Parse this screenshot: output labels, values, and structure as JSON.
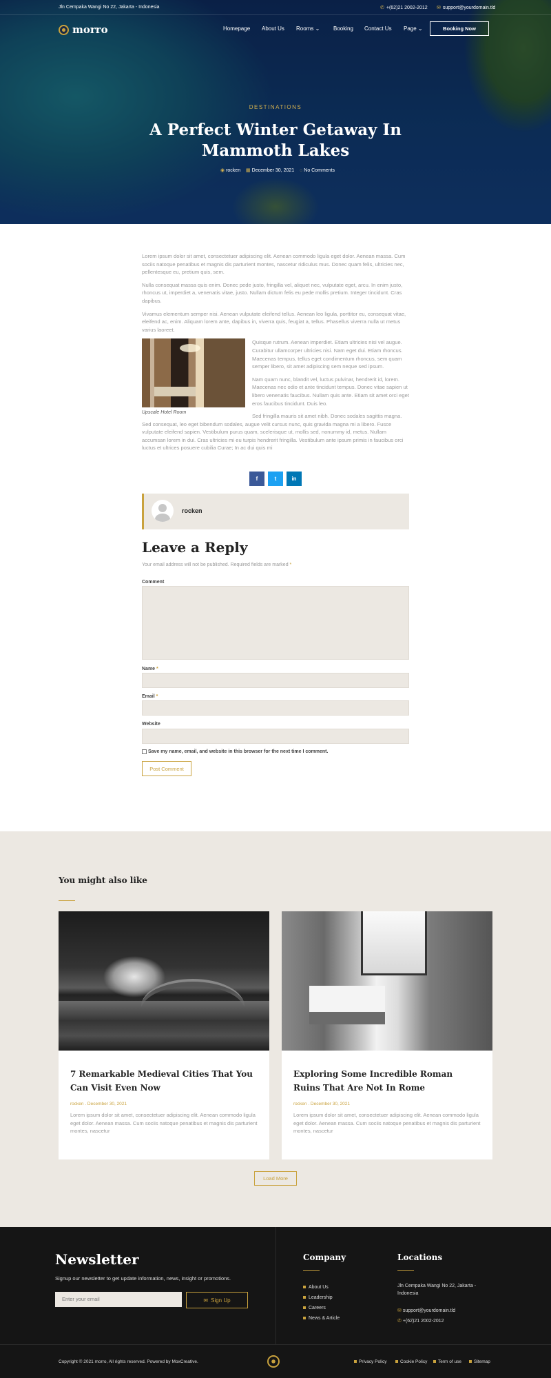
{
  "topbar": {
    "address": "Jln Cempaka Wangi No 22, Jakarta - Indonesia",
    "phone": "+(62)21 2002-2012",
    "email": "support@yourdomain.tld"
  },
  "brand": {
    "name": "morro",
    "accent": "#c9a23d"
  },
  "nav": {
    "items": [
      "Homepage",
      "About Us",
      "Rooms",
      "Booking",
      "Contact Us",
      "Page"
    ],
    "dropdown_arrow": "⌄",
    "cta": "Booking Now"
  },
  "hero": {
    "category": "DESTINATIONS",
    "title": "A Perfect Winter Getaway In Mammoth Lakes",
    "author": "rocken",
    "date": "December 30, 2021",
    "comments": "No Comments"
  },
  "article": {
    "p1": "Lorem ipsum dolor sit amet, consectetuer adipiscing elit. Aenean commodo ligula eget dolor. Aenean massa. Cum sociis natoque penatibus et magnis dis parturient montes, nascetur ridiculus mus. Donec quam felis, ultricies nec, pellentesque eu, pretium quis, sem.",
    "p2": "Nulla consequat massa quis enim. Donec pede justo, fringilla vel, aliquet nec, vulputate eget, arcu. In enim justo, rhoncus ut, imperdiet a, venenatis vitae, justo. Nullam dictum felis eu pede mollis pretium. Integer tincidunt. Cras dapibus.",
    "p3": "Vivamus elementum semper nisi. Aenean vulputate eleifend tellus. Aenean leo ligula, porttitor eu, consequat vitae, eleifend ac, enim. Aliquam lorem ante, dapibus in, viverra quis, feugiat a, tellus. Phasellus viverra nulla ut metus varius laoreet.",
    "image_caption": "Upscale Hotel Room",
    "p4": "Quisque rutrum. Aenean imperdiet. Etiam ultricies nisi vel augue. Curabitur ullamcorper ultricies nisi. Nam eget dui. Etiam rhoncus. Maecenas tempus, tellus eget condimentum rhoncus, sem quam semper libero, sit amet adipiscing sem neque sed ipsum.",
    "p5": "Nam quam nunc, blandit vel, luctus pulvinar, hendrerit id, lorem. Maecenas nec odio et ante tincidunt tempus. Donec vitae sapien ut libero venenatis faucibus. Nullam quis ante. Etiam sit amet orci eget eros faucibus tincidunt. Duis leo.",
    "p6": "Sed fringilla mauris sit amet nibh. Donec sodales sagittis magna. Sed consequat, leo eget bibendum sodales, augue velit cursus nunc, quis gravida magna mi a libero. Fusce vulputate eleifend sapien. Vestibulum purus quam, scelerisque ut, mollis sed, nonummy id, metus. Nullam accumsan lorem in dui. Cras ultricies mi eu turpis hendrerit fringilla. Vestibulum ante ipsum primis in faucibus orci luctus et ultrices posuere cubilia Curae; In ac dui quis mi"
  },
  "share": {
    "icons": [
      "facebook-icon",
      "twitter-icon",
      "linkedin-icon"
    ],
    "glyphs": [
      "f",
      "t",
      "in"
    ],
    "colors": [
      "#3b5998",
      "#1da1f2",
      "#0077b5"
    ]
  },
  "author_box": {
    "name": "rocken"
  },
  "reply": {
    "title": "Leave a Reply",
    "note": "Your email address will not be published. Required fields are marked",
    "required_mark": "*",
    "comment_label": "Comment",
    "name_label": "Name",
    "email_label": "Email",
    "website_label": "Website",
    "consent": "Save my name, email, and website in this browser for the next time I comment.",
    "submit": "Post Comment"
  },
  "related": {
    "title": "You might also like",
    "cards": [
      {
        "title": "7 Remarkable Medieval Cities That You Can Visit Even Now",
        "meta": "rocken . December 30, 2021",
        "excerpt": "Lorem ipsum dolor sit amet, consectetuer adipiscing elit. Aenean commodo ligula eget dolor. Aenean massa. Cum sociis natoque penatibus et magnis dis parturient montes, nascetur"
      },
      {
        "title": "Exploring Some Incredible Roman Ruins That Are Not In Rome",
        "meta": "rocken . December 30, 2021",
        "excerpt": "Lorem ipsum dolor sit amet, consectetuer adipiscing elit. Aenean commodo ligula eget dolor. Aenean massa. Cum sociis natoque penatibus et magnis dis parturient montes, nascetur"
      }
    ],
    "load_more": "Load More"
  },
  "footer": {
    "newsletter_title": "Newsletter",
    "newsletter_text": "Signup our newsletter to get update information, news, insight or promotions.",
    "email_placeholder": "Enter your email",
    "signup": "Sign Up",
    "company_title": "Company",
    "company_links": [
      "About Us",
      "Leadership",
      "Careers",
      "News & Article"
    ],
    "locations_title": "Locations",
    "location_address": "Jln Cempaka Wangi No 22, Jakarta - Indonesia",
    "location_email": "support@yourdomain.tld",
    "location_phone": "+(62)21 2002-2012",
    "copyright": "Copyright © 2021 morro, All rights reserved. Powered by MoxCreative.",
    "legal_links": [
      "Privacy Policy",
      "Cookie Policy",
      "Term of use",
      "Sitemap"
    ]
  }
}
